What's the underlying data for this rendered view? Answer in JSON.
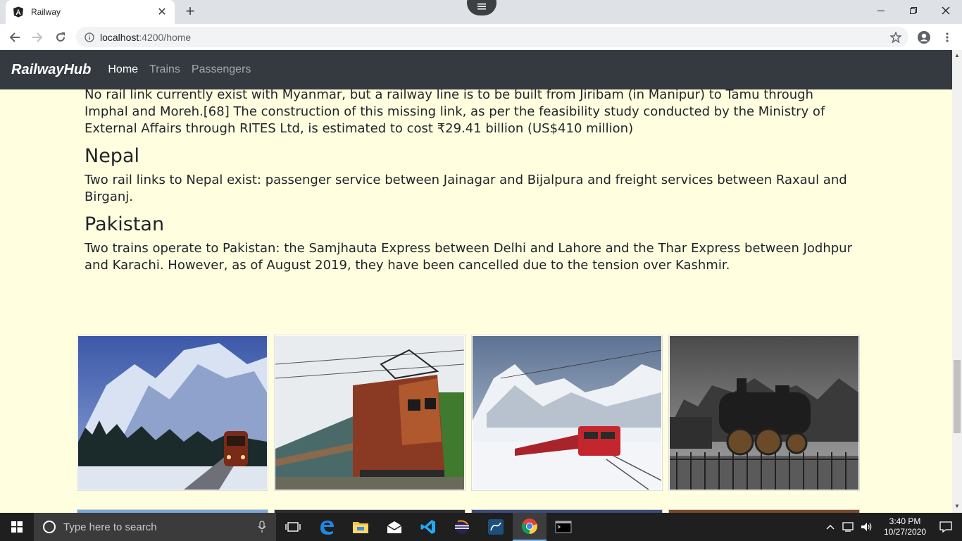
{
  "browser": {
    "tab_title": "Railway",
    "url_host": "localhost",
    "url_path": ":4200/home"
  },
  "navbar": {
    "brand": "RailwayHub",
    "links": [
      "Home",
      "Trains",
      "Passengers"
    ],
    "active": "Home"
  },
  "article": {
    "para_myanmar": "No rail link currently exist with Myanmar, but a railway line is to be built from Jiribam (in Manipur) to Tamu through Imphal and Moreh.[68] The construction of this missing link, as per the feasibility study conducted by the Ministry of External Affairs through RITES Ltd, is estimated to cost ₹29.41 billion (US$410 million)",
    "heading_nepal": "Nepal",
    "para_nepal": "Two rail links to Nepal exist: passenger service between Jainagar and Bijalpura and freight services between Raxaul and Birganj.",
    "heading_pakistan": "Pakistan",
    "para_pakistan": "Two trains operate to Pakistan: the Samjhauta Express between Delhi and Lahore and the Thar Express between Jodhpur and Karachi. However, as of August 2019, they have been cancelled due to the tension over Kashmir."
  },
  "gallery": {
    "images": [
      "train-snow-mountains",
      "electric-locomotive",
      "red-train-snow",
      "steam-locomotive"
    ]
  },
  "taskbar": {
    "search_placeholder": "Type here to search",
    "time": "3:40 PM",
    "date": "10/27/2020"
  }
}
